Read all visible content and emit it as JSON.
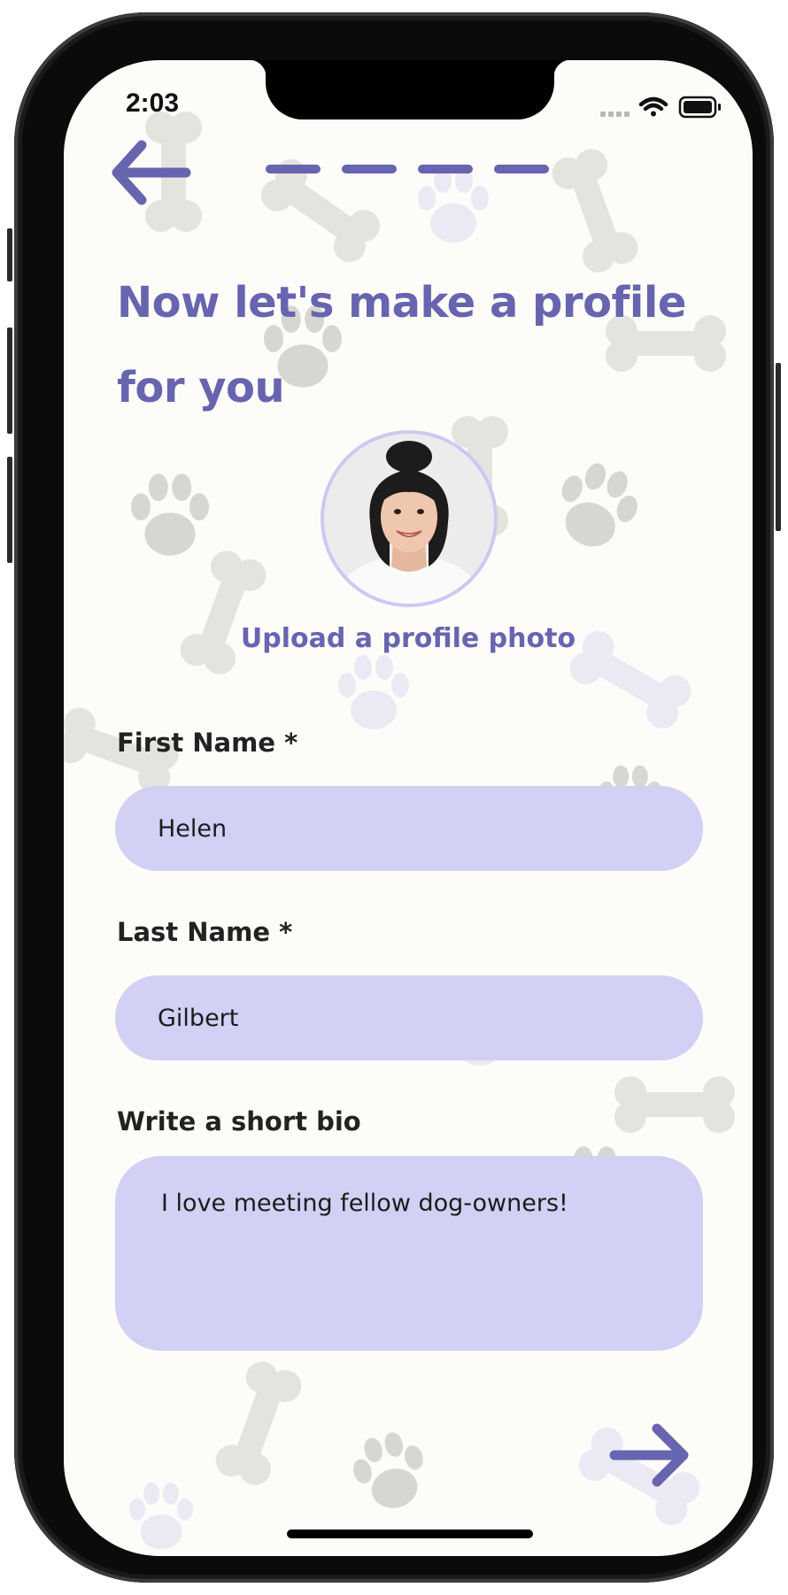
{
  "status_bar": {
    "time": "2:03"
  },
  "nav": {
    "back_icon": "arrow-left-icon",
    "progress_steps": 4,
    "next_icon": "arrow-right-icon"
  },
  "page": {
    "title": "Now let's make a profile for you",
    "upload_label": "Upload a profile photo",
    "avatar_icon": "profile-photo"
  },
  "form": {
    "first_name": {
      "label": "First Name *",
      "value": "Helen"
    },
    "last_name": {
      "label": "Last Name *",
      "value": "Gilbert"
    },
    "bio": {
      "label": "Write a short bio",
      "value": "I love meeting fellow dog-owners!"
    }
  },
  "colors": {
    "accent": "#6764b0",
    "field_background": "#d2d0f4",
    "screen_background": "#fdfcf8",
    "pattern_gray": "#d4d4cf",
    "pattern_lavender": "#e6e5f3"
  }
}
